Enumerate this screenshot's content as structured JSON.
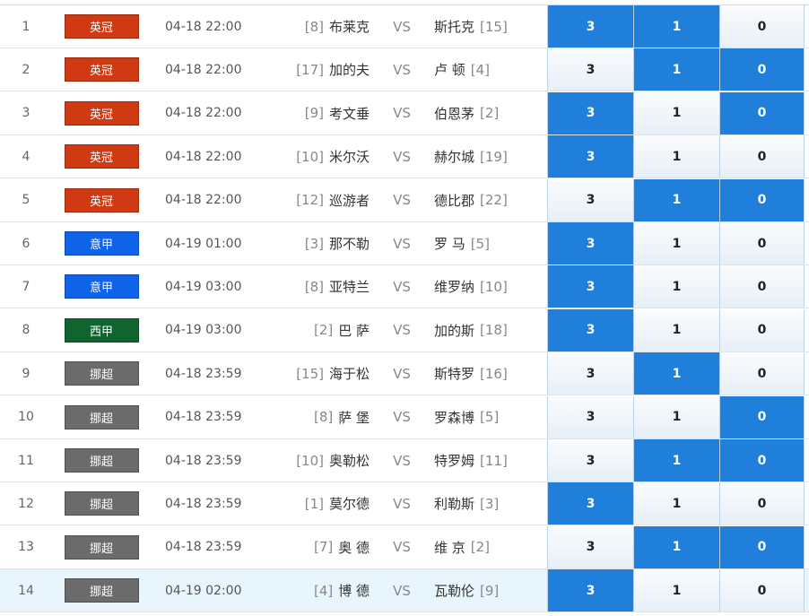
{
  "colors": {
    "yingguan": "#d03a12",
    "yijia": "#0e63e8",
    "xijia": "#10652f",
    "nuochao": "#6b6b6b",
    "selected": "#217fdc"
  },
  "vs_label": "VS",
  "matches": [
    {
      "num": "1",
      "league": "英冠",
      "league_color": "#d03a12",
      "time": "04-18 22:00",
      "home_rank": "[8]",
      "home": "布莱克",
      "away": "斯托克",
      "away_rank": "[15]",
      "odds": [
        "3",
        "1",
        "0"
      ],
      "selected": [
        true,
        true,
        false
      ]
    },
    {
      "num": "2",
      "league": "英冠",
      "league_color": "#d03a12",
      "time": "04-18 22:00",
      "home_rank": "[17]",
      "home": "加的夫",
      "away": "卢 顿",
      "away_rank": "[4]",
      "odds": [
        "3",
        "1",
        "0"
      ],
      "selected": [
        false,
        true,
        true
      ]
    },
    {
      "num": "3",
      "league": "英冠",
      "league_color": "#d03a12",
      "time": "04-18 22:00",
      "home_rank": "[9]",
      "home": "考文垂",
      "away": "伯恩茅",
      "away_rank": "[2]",
      "odds": [
        "3",
        "1",
        "0"
      ],
      "selected": [
        true,
        false,
        true
      ]
    },
    {
      "num": "4",
      "league": "英冠",
      "league_color": "#d03a12",
      "time": "04-18 22:00",
      "home_rank": "[10]",
      "home": "米尔沃",
      "away": "赫尔城",
      "away_rank": "[19]",
      "odds": [
        "3",
        "1",
        "0"
      ],
      "selected": [
        true,
        false,
        false
      ]
    },
    {
      "num": "5",
      "league": "英冠",
      "league_color": "#d03a12",
      "time": "04-18 22:00",
      "home_rank": "[12]",
      "home": "巡游者",
      "away": "德比郡",
      "away_rank": "[22]",
      "odds": [
        "3",
        "1",
        "0"
      ],
      "selected": [
        false,
        true,
        true
      ]
    },
    {
      "num": "6",
      "league": "意甲",
      "league_color": "#0e63e8",
      "time": "04-19 01:00",
      "home_rank": "[3]",
      "home": "那不勒",
      "away": "罗 马",
      "away_rank": "[5]",
      "odds": [
        "3",
        "1",
        "0"
      ],
      "selected": [
        true,
        false,
        false
      ]
    },
    {
      "num": "7",
      "league": "意甲",
      "league_color": "#0e63e8",
      "time": "04-19 03:00",
      "home_rank": "[8]",
      "home": "亚特兰",
      "away": "维罗纳",
      "away_rank": "[10]",
      "odds": [
        "3",
        "1",
        "0"
      ],
      "selected": [
        true,
        false,
        false
      ]
    },
    {
      "num": "8",
      "league": "西甲",
      "league_color": "#10652f",
      "time": "04-19 03:00",
      "home_rank": "[2]",
      "home": "巴 萨",
      "away": "加的斯",
      "away_rank": "[18]",
      "odds": [
        "3",
        "1",
        "0"
      ],
      "selected": [
        true,
        false,
        false
      ]
    },
    {
      "num": "9",
      "league": "挪超",
      "league_color": "#6b6b6b",
      "time": "04-18 23:59",
      "home_rank": "[15]",
      "home": "海于松",
      "away": "斯特罗",
      "away_rank": "[16]",
      "odds": [
        "3",
        "1",
        "0"
      ],
      "selected": [
        false,
        true,
        false
      ]
    },
    {
      "num": "10",
      "league": "挪超",
      "league_color": "#6b6b6b",
      "time": "04-18 23:59",
      "home_rank": "[8]",
      "home": "萨 堡",
      "away": "罗森博",
      "away_rank": "[5]",
      "odds": [
        "3",
        "1",
        "0"
      ],
      "selected": [
        false,
        false,
        true
      ]
    },
    {
      "num": "11",
      "league": "挪超",
      "league_color": "#6b6b6b",
      "time": "04-18 23:59",
      "home_rank": "[10]",
      "home": "奥勒松",
      "away": "特罗姆",
      "away_rank": "[11]",
      "odds": [
        "3",
        "1",
        "0"
      ],
      "selected": [
        false,
        true,
        true
      ]
    },
    {
      "num": "12",
      "league": "挪超",
      "league_color": "#6b6b6b",
      "time": "04-18 23:59",
      "home_rank": "[1]",
      "home": "莫尔德",
      "away": "利勒斯",
      "away_rank": "[3]",
      "odds": [
        "3",
        "1",
        "0"
      ],
      "selected": [
        true,
        false,
        false
      ]
    },
    {
      "num": "13",
      "league": "挪超",
      "league_color": "#6b6b6b",
      "time": "04-18 23:59",
      "home_rank": "[7]",
      "home": "奥 德",
      "away": "维 京",
      "away_rank": "[2]",
      "odds": [
        "3",
        "1",
        "0"
      ],
      "selected": [
        false,
        true,
        true
      ]
    },
    {
      "num": "14",
      "league": "挪超",
      "league_color": "#6b6b6b",
      "time": "04-19 02:00",
      "home_rank": "[4]",
      "home": "博 德",
      "away": "瓦勒伦",
      "away_rank": "[9]",
      "odds": [
        "3",
        "1",
        "0"
      ],
      "selected": [
        true,
        false,
        false
      ],
      "highlight": true
    }
  ]
}
